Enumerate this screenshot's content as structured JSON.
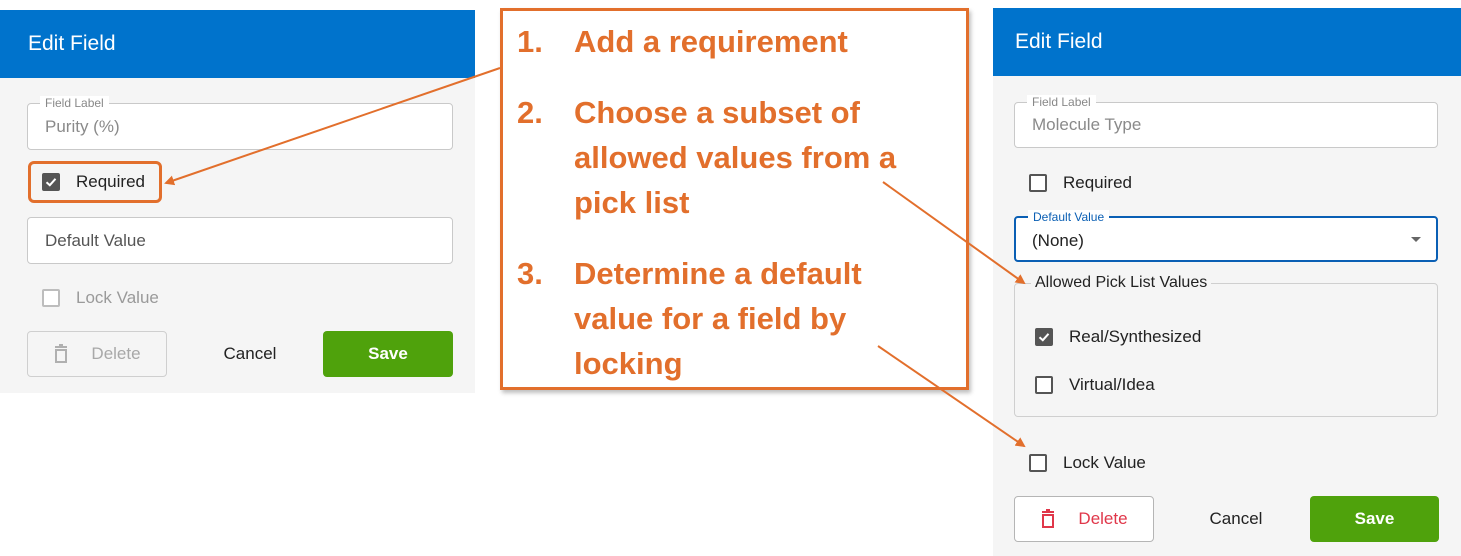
{
  "left_panel": {
    "title": "Edit Field",
    "field_label": {
      "legend": "Field Label",
      "value": "Purity (%)"
    },
    "required": {
      "label": "Required",
      "checked": true
    },
    "default_value": {
      "placeholder": "Default Value"
    },
    "lock_value": {
      "label": "Lock Value",
      "checked": false,
      "disabled": true
    },
    "buttons": {
      "delete": "Delete",
      "cancel": "Cancel",
      "save": "Save"
    }
  },
  "callout": {
    "steps": [
      {
        "num": "1.",
        "text": "Add a requirement"
      },
      {
        "num": "2.",
        "text": "Choose a subset of allowed values from a pick list"
      },
      {
        "num": "3.",
        "text": "Determine a default value for a field by locking"
      }
    ],
    "color": "#e26f2c"
  },
  "right_panel": {
    "title": "Edit Field",
    "field_label": {
      "legend": "Field Label",
      "value": "Molecule Type"
    },
    "required": {
      "label": "Required",
      "checked": false
    },
    "default_value": {
      "legend": "Default Value",
      "value": "(None)"
    },
    "allowed_pick_list": {
      "legend": "Allowed Pick List Values",
      "options": [
        {
          "label": "Real/Synthesized",
          "checked": true
        },
        {
          "label": "Virtual/Idea",
          "checked": false
        }
      ]
    },
    "lock_value": {
      "label": "Lock Value",
      "checked": false
    },
    "buttons": {
      "delete": "Delete",
      "cancel": "Cancel",
      "save": "Save"
    }
  },
  "colors": {
    "header": "#0073cc",
    "save": "#4fa20c",
    "delete_red": "#e0374a",
    "focus_blue": "#0a5fb4",
    "annotation": "#e26f2c"
  },
  "icons": [
    "check-icon",
    "trash-icon",
    "dropdown-arrow-icon",
    "arrow-icon"
  ]
}
